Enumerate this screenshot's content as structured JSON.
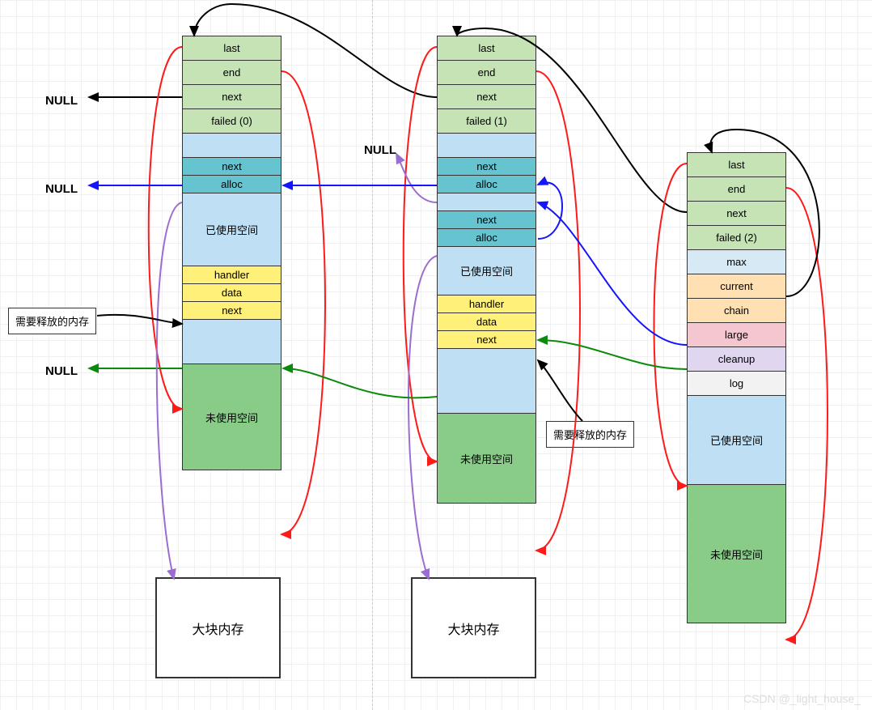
{
  "labels": {
    "null1": "NULL",
    "null2": "NULL",
    "null3": "NULL",
    "null4": "NULL"
  },
  "notes": {
    "release1": "需要释放的内存",
    "release2": "需要释放的内存"
  },
  "bigBlocks": {
    "left": "大块内存",
    "mid": "大块内存"
  },
  "block1": {
    "last": "last",
    "end": "end",
    "next": "next",
    "failed": "failed (0)",
    "l_next": "next",
    "l_alloc": "alloc",
    "used": "已使用空间",
    "h_handler": "handler",
    "h_data": "data",
    "h_next": "next",
    "unused": "未使用空间"
  },
  "block2": {
    "last": "last",
    "end": "end",
    "next": "next",
    "failed": "failed (1)",
    "l1_next": "next",
    "l1_alloc": "alloc",
    "l2_next": "next",
    "l2_alloc": "alloc",
    "used": "已使用空间",
    "h_handler": "handler",
    "h_data": "data",
    "h_next": "next",
    "unused": "未使用空间"
  },
  "block3": {
    "last": "last",
    "end": "end",
    "next": "next",
    "failed": "failed (2)",
    "max": "max",
    "current": "current",
    "chain": "chain",
    "large": "large",
    "cleanup": "cleanup",
    "log": "log",
    "used": "已使用空间",
    "unused": "未使用空间"
  },
  "watermark": "CSDN @_light_house_"
}
